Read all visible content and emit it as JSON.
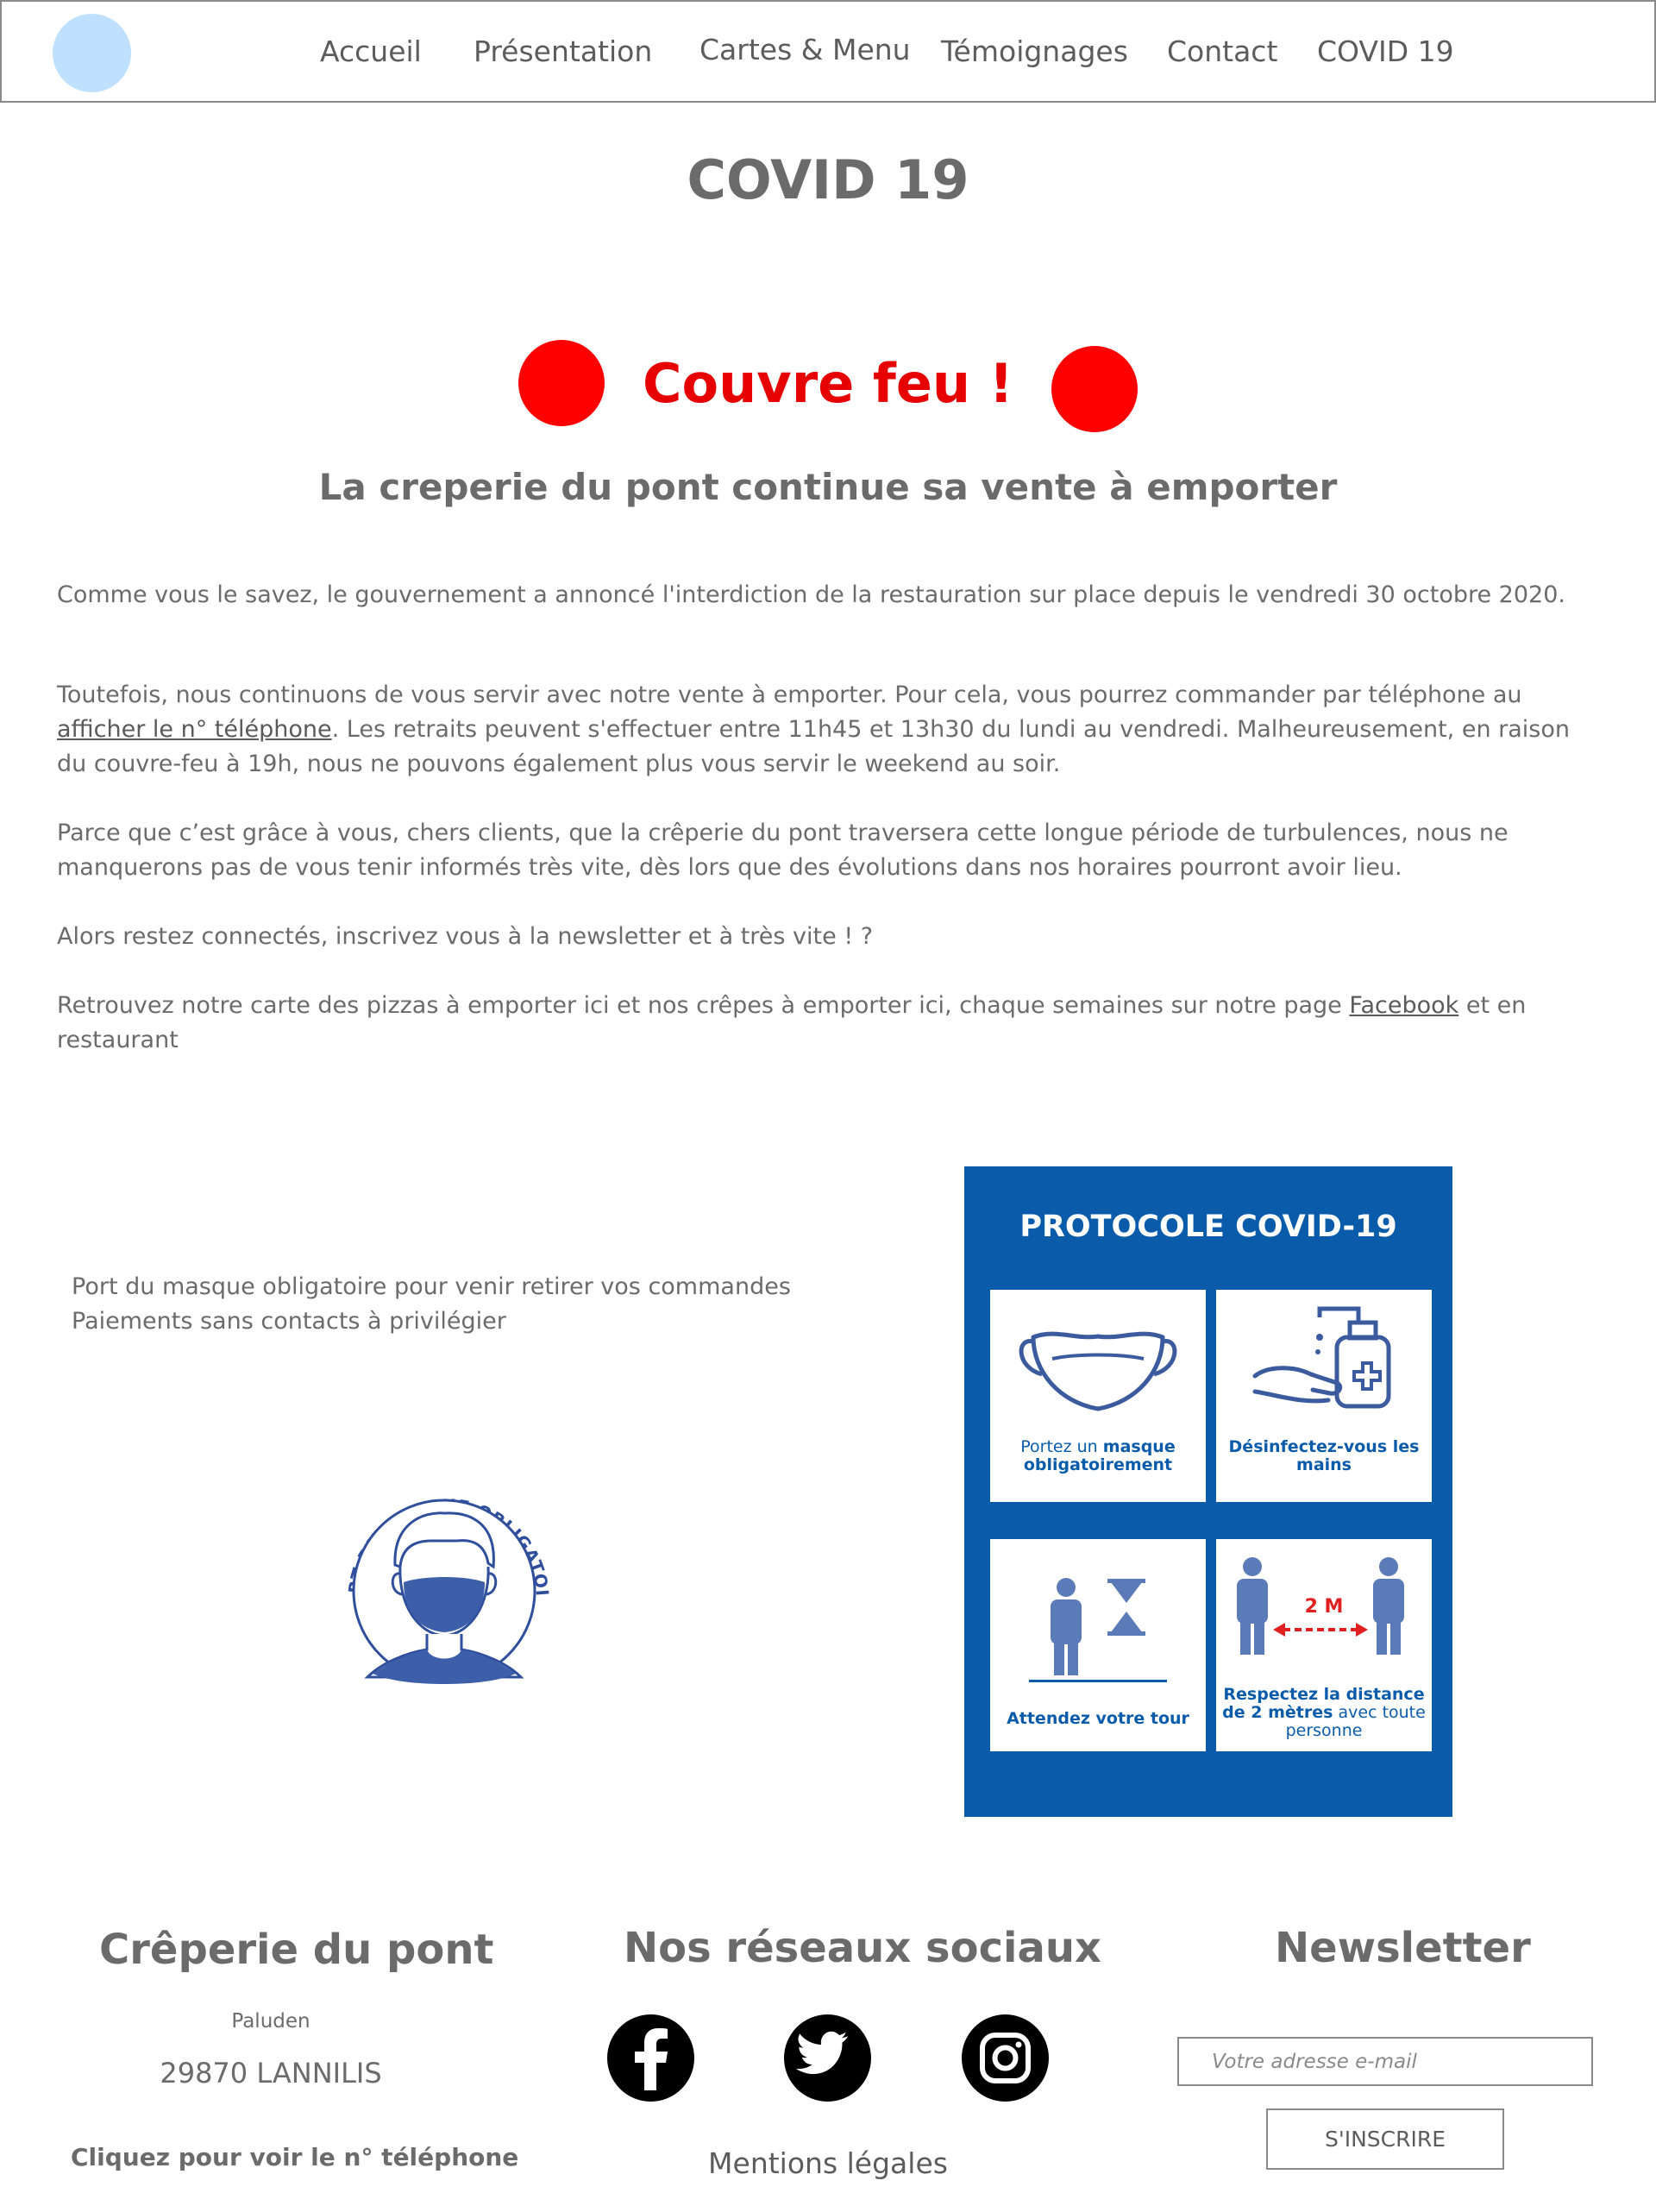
{
  "nav": {
    "items": [
      "Accueil",
      "Présentation",
      "Cartes & Menu",
      "Témoignages",
      "Contact",
      "COVID 19"
    ]
  },
  "main": {
    "title": "COVID 19",
    "curfew_title": "Couvre feu !",
    "subtitle": "La creperie du pont continue sa vente à emporter",
    "para1": "Comme vous le savez, le gouvernement a annoncé l'interdiction de la restauration sur place depuis le vendredi 30 octobre 2020.",
    "para2_before": "Toutefois, nous continuons de vous servir avec notre vente à emporter. Pour cela, vous pourrez commander par téléphone au",
    "para2_link": "afficher le n° téléphone",
    "para2_after": ". Les retraits peuvent s'effectuer entre 11h45 et 13h30 du lundi au vendredi. Malheureusement, en raison du couvre-feu à 19h, nous ne pouvons également plus vous servir le weekend au soir.",
    "para3": "Parce que c’est grâce à vous, chers clients, que la crêperie du pont traversera cette longue période de turbulences, nous ne manquerons pas de vous tenir informés très vite, dès lors que des évolutions dans nos horaires pourront avoir lieu.",
    "para4": "Alors restez connectés, inscrivez vous à la newsletter et à très vite ! ?",
    "para5_before": "Retrouvez notre carte des pizzas à emporter ici et nos crêpes à emporter ici, chaque semaines sur notre page",
    "para5_link": "Facebook",
    "para5_after": "et en restaurant"
  },
  "mask_section": {
    "line1": "Port du masque obligatoire pour venir retirer vos commandes",
    "line2": "Paiements sans contacts à privilégier",
    "badge_text": "PORT DU MASQUE OBLIGATOIRE"
  },
  "poster": {
    "title": "PROTOCOLE COVID-19",
    "card1_plain": "Portez un",
    "card1_bold1": "masque",
    "card1_bold2": "obligatoirement",
    "card2": "Désinfectez-vous les mains",
    "card3": "Attendez votre tour",
    "card4_label": "2 M",
    "card4_bold": "Respectez la distance de 2 mètres",
    "card4_plain": "avec toute personne"
  },
  "footer": {
    "brand": "Crêperie du pont",
    "place": "Paluden",
    "city": "29870 LANNILIS",
    "phone_link": "Cliquez pour voir le n° téléphone",
    "social_heading": "Nos réseaux sociaux",
    "legal": "Mentions légales",
    "newsletter_heading": "Newsletter",
    "email_placeholder": "Votre adresse e-mail",
    "subscribe": "S'INSCRIRE"
  },
  "colors": {
    "accent_red": "#e60000",
    "poster_blue": "#0a5caa",
    "logo_blue": "#bfe0ff",
    "text_gray": "#6b6b6b"
  }
}
